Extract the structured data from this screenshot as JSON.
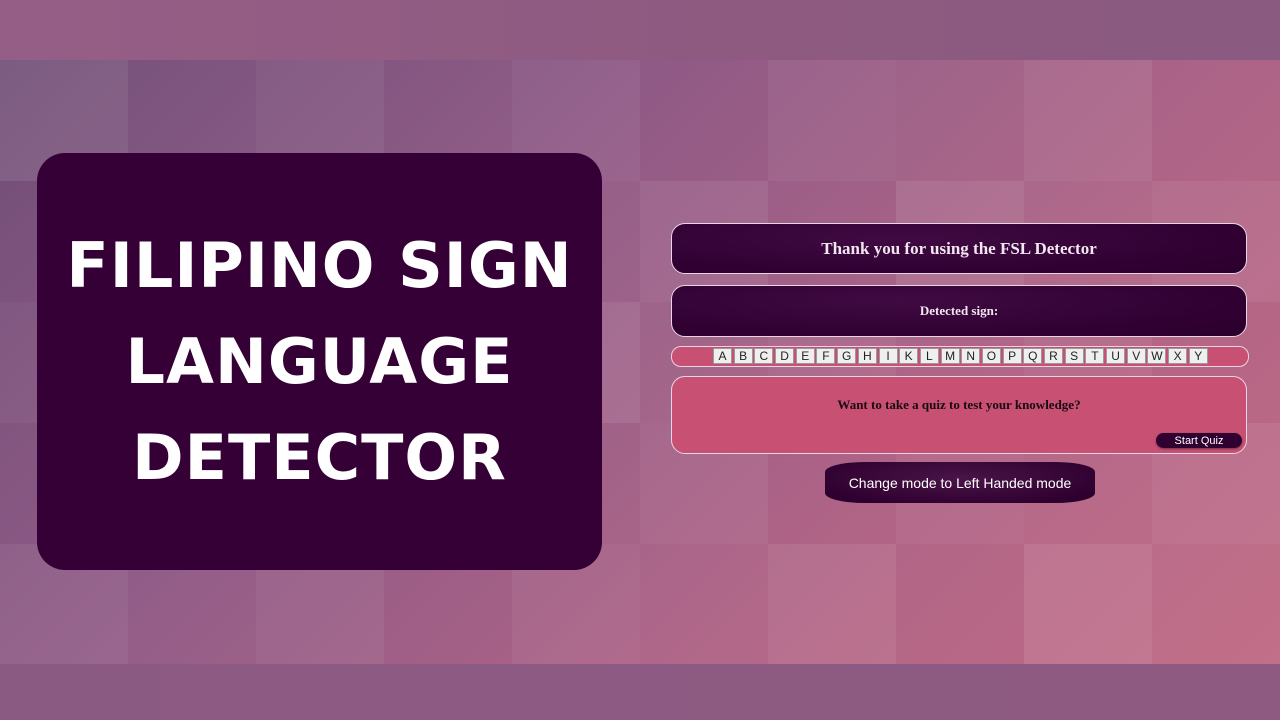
{
  "title_card": {
    "heading": "FILIPINO SIGN\nLANGUAGE\nDETECTOR"
  },
  "app": {
    "thanks_message": "Thank you for using the FSL Detector",
    "detected_label": "Detected sign:",
    "alphabet": [
      "A",
      "B",
      "C",
      "D",
      "E",
      "F",
      "G",
      "H",
      "I",
      "K",
      "L",
      "M",
      "N",
      "O",
      "P",
      "Q",
      "R",
      "S",
      "T",
      "U",
      "V",
      "W",
      "X",
      "Y"
    ],
    "quiz_prompt": "Want to take a quiz to test your knowledge?",
    "start_quiz_label": "Start Quiz",
    "mode_button_label": "Change mode to Left Handed mode"
  },
  "colors": {
    "card_bg": "#350036",
    "accent_pink": "#c85073",
    "background": "#8c5a82"
  }
}
